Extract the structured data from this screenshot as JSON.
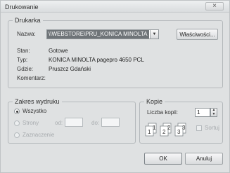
{
  "window": {
    "title": "Drukowanie",
    "close_symbol": "×"
  },
  "printer": {
    "group_label": "Drukarka",
    "name_label": "Nazwa:",
    "name_value": "\\\\WEBSTORE\\PRU_KONICA MINOLTA",
    "properties_button": "Właściwości...",
    "status_label": "Stan:",
    "status_value": "Gotowe",
    "type_label": "Typ:",
    "type_value": "KONICA MINOLTA pagepro 4650 PCL",
    "location_label": "Gdzie:",
    "location_value": "Pruszcz Gdański",
    "comment_label": "Komentarz:",
    "comment_value": ""
  },
  "range": {
    "group_label": "Zakres wydruku",
    "all_label": "Wszystko",
    "pages_label": "Strony",
    "from_label": "od:",
    "to_label": "do:",
    "selection_label": "Zaznaczenie",
    "selected": "all"
  },
  "copies": {
    "group_label": "Kopie",
    "count_label": "Liczba kopii:",
    "count_value": "1",
    "collate_label": "Sortuj"
  },
  "buttons": {
    "ok": "OK",
    "cancel": "Anuluj"
  },
  "icons": {
    "close": "close-icon",
    "dropdown": "chevron-down-icon",
    "collate": "collate-pages-icon"
  }
}
